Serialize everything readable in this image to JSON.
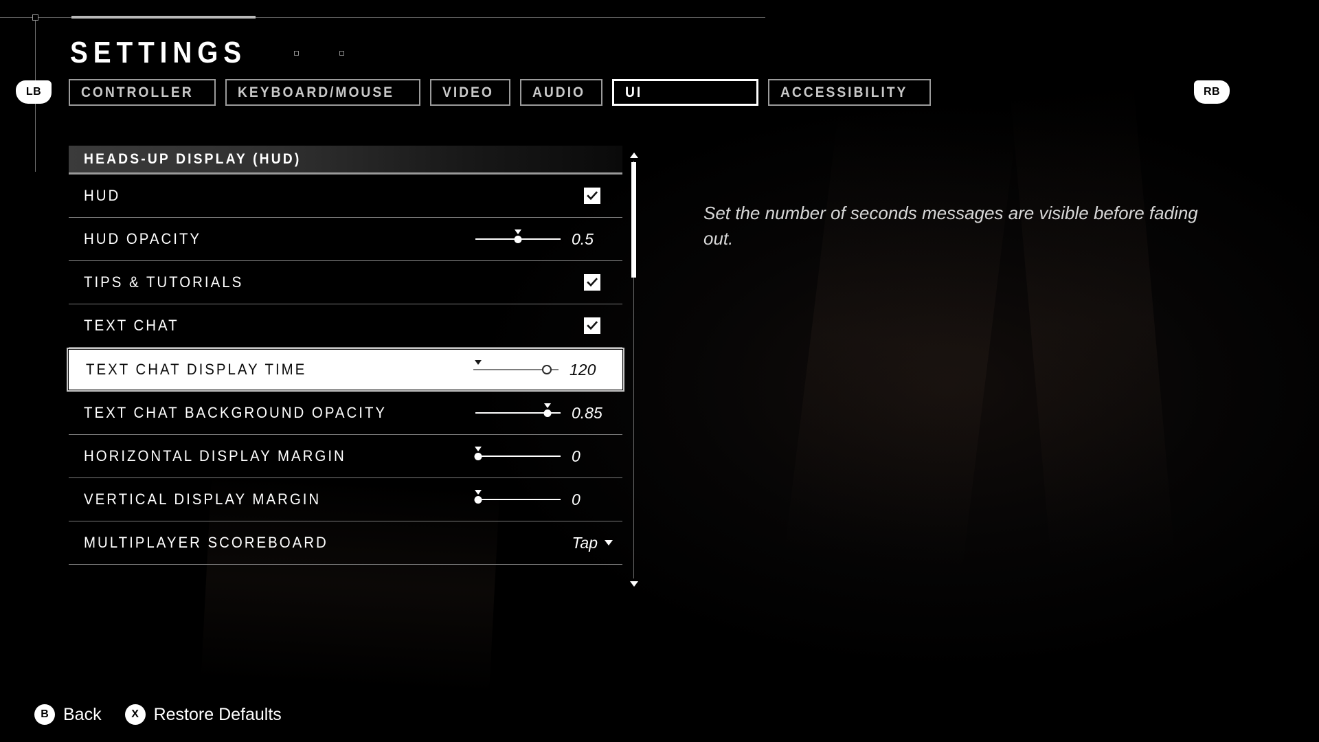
{
  "header": {
    "title": "SETTINGS",
    "bumper_left": "LB",
    "bumper_right": "RB",
    "tabs": [
      {
        "label": "CONTROLLER",
        "active": false
      },
      {
        "label": "KEYBOARD/MOUSE",
        "active": false
      },
      {
        "label": "VIDEO",
        "active": false
      },
      {
        "label": "AUDIO",
        "active": false
      },
      {
        "label": "UI",
        "active": true
      },
      {
        "label": "ACCESSIBILITY",
        "active": false
      }
    ]
  },
  "list": {
    "group_title": "HEADS-UP DISPLAY (HUD)",
    "rows": [
      {
        "label": "HUD",
        "type": "checkbox",
        "checked": true,
        "selected": false
      },
      {
        "label": "HUD OPACITY",
        "type": "slider",
        "value": "0.5",
        "fill": 50,
        "selected": false
      },
      {
        "label": "TIPS & TUTORIALS",
        "type": "checkbox",
        "checked": true,
        "selected": false
      },
      {
        "label": "TEXT CHAT",
        "type": "checkbox",
        "checked": true,
        "selected": false
      },
      {
        "label": "TEXT CHAT DISPLAY TIME",
        "type": "slider",
        "value": "120",
        "fill": 86,
        "selected": true
      },
      {
        "label": "TEXT CHAT BACKGROUND OPACITY",
        "type": "slider",
        "value": "0.85",
        "fill": 85,
        "selected": false
      },
      {
        "label": "HORIZONTAL DISPLAY MARGIN",
        "type": "slider",
        "value": "0",
        "fill": 3,
        "selected": false
      },
      {
        "label": "VERTICAL DISPLAY MARGIN",
        "type": "slider",
        "value": "0",
        "fill": 3,
        "selected": false
      },
      {
        "label": "MULTIPLAYER SCOREBOARD",
        "type": "dropdown",
        "value": "Tap",
        "selected": false
      }
    ]
  },
  "description": "Set the number of seconds messages are visible before fading out.",
  "footer": {
    "actions": [
      {
        "glyph": "B",
        "label": "Back"
      },
      {
        "glyph": "X",
        "label": "Restore Defaults"
      }
    ]
  },
  "colors": {
    "background": "#000000",
    "accent_white": "#ffffff",
    "border_dim": "#9b9b9b",
    "text_dim": "#c9c9c9",
    "separator": "#7c7c7c"
  }
}
